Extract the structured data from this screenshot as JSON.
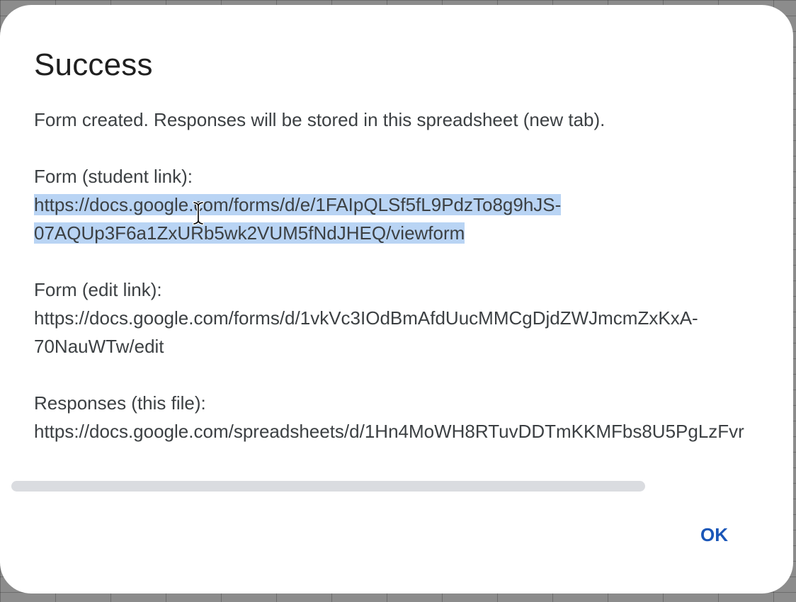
{
  "dialog": {
    "title": "Success",
    "message": "Form created. Responses will be stored in this spreadsheet (new tab).",
    "student_link_label": "Form (student link):",
    "student_link_line1": "https://docs.google.com/forms/d/e/1FAIpQLSf5fL9PdzTo8g9hJS-",
    "student_link_line2": "07AQUp3F6a1ZxURb5wk2VUM5fNdJHEQ/viewform",
    "edit_link_label": "Form (edit link):",
    "edit_link_line1": "https://docs.google.com/forms/d/1vkVc3IOdBmAfdUucMMCgDjdZWJmcmZxKxA-",
    "edit_link_line2": "70NauWTw/edit",
    "responses_label": "Responses (this file):",
    "responses_link": "https://docs.google.com/spreadsheets/d/1Hn4MoWH8RTuvDDTmKKMFbs8U5PgLzFvr",
    "ok_label": "OK"
  },
  "colors": {
    "selection": "#b9d4f4",
    "button_text": "#1a56b8",
    "body_text": "#3c4043"
  },
  "icons": {
    "cursor": "text-cursor-icon"
  }
}
